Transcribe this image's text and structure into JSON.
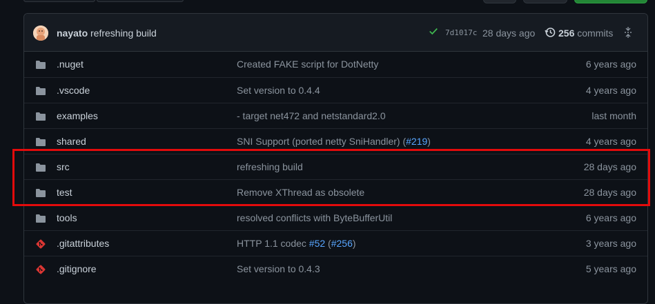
{
  "commit": {
    "author": "nayato",
    "message": "refreshing build",
    "sha": "7d1017c",
    "age": "28 days ago",
    "commit_count": "256",
    "commit_label": "commits"
  },
  "files": [
    {
      "type": "folder",
      "name": ".nuget",
      "message": "Created FAKE script for DotNetty",
      "links": [],
      "age": "6 years ago"
    },
    {
      "type": "folder",
      "name": ".vscode",
      "message": "Set version to 0.4.4",
      "links": [],
      "age": "4 years ago"
    },
    {
      "type": "folder",
      "name": "examples",
      "message": "- target net472 and netstandard2.0",
      "links": [],
      "age": "last month"
    },
    {
      "type": "folder",
      "name": "shared",
      "message": "SNI Support (ported netty SniHandler) (",
      "links": [
        "#219"
      ],
      "suffix": ")",
      "age": "4 years ago"
    },
    {
      "type": "folder",
      "name": "src",
      "message": "refreshing build",
      "links": [],
      "age": "28 days ago"
    },
    {
      "type": "folder",
      "name": "test",
      "message": "Remove XThread as obsolete",
      "links": [],
      "age": "28 days ago"
    },
    {
      "type": "folder",
      "name": "tools",
      "message": "resolved conflicts with ByteBufferUtil",
      "links": [],
      "age": "6 years ago"
    },
    {
      "type": "file",
      "name": ".gitattributes",
      "message": "HTTP 1.1 codec ",
      "links": [
        "#52",
        " (",
        "#256"
      ],
      "suffix": ")",
      "age": "3 years ago"
    },
    {
      "type": "file",
      "name": ".gitignore",
      "message": "Set version to 0.4.3",
      "links": [],
      "age": "5 years ago"
    }
  ],
  "colors": {
    "background": "#0d1117",
    "folder_icon": "#8b949e",
    "git_file_icon": "#da3633",
    "link": "#58a6ff",
    "success": "#3fb950",
    "highlight_box": "#e30b0b"
  }
}
